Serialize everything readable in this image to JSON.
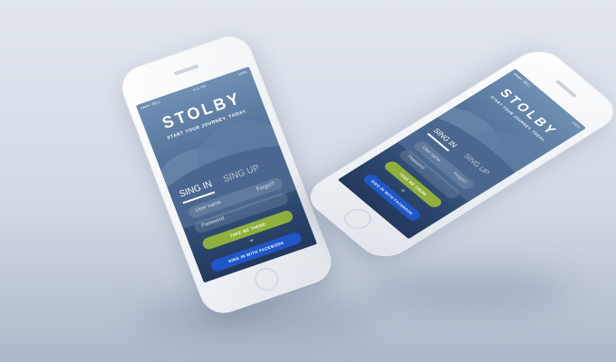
{
  "app": {
    "title": "STOLBY",
    "subtitle": "START YOUR JOURNEY. TODAY.",
    "status": {
      "carrier": "●●●●○ BELL",
      "time": "4:21 PM",
      "battery": "100%"
    },
    "tabs": [
      {
        "label": "SING IN",
        "active": true
      },
      {
        "label": "SING UP",
        "active": false
      }
    ],
    "username_placeholder": "User name",
    "password_placeholder": "Password",
    "forgot_label": "Forgot?",
    "primary_button": "TAKE ME THERE",
    "or_label": "or",
    "facebook_button": "SING IN WITH FACEBOOK"
  },
  "colors": {
    "primary": "#8fb03e",
    "facebook": "#1f56c9",
    "screen_top": "#6f8fb3",
    "screen_bottom": "#23375c"
  }
}
